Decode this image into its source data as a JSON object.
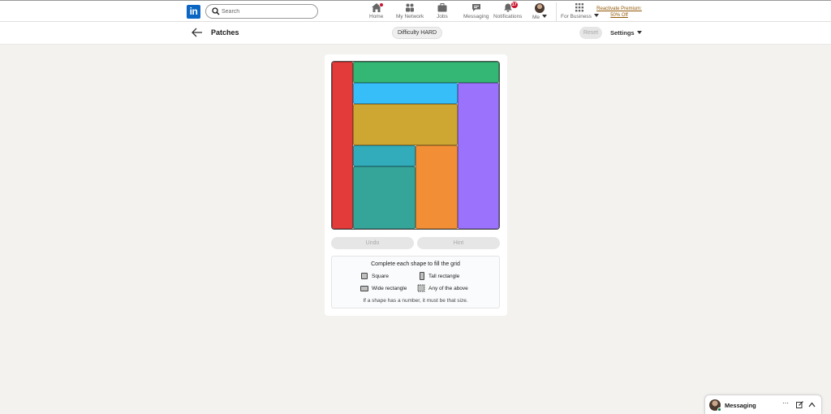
{
  "nav": {
    "logo_text": "in",
    "search_placeholder": "Search",
    "items": [
      {
        "label": "Home",
        "icon": "home-icon"
      },
      {
        "label": "My Network",
        "icon": "network-icon"
      },
      {
        "label": "Jobs",
        "icon": "briefcase-icon"
      },
      {
        "label": "Messaging",
        "icon": "chat-icon"
      },
      {
        "label": "Notifications",
        "icon": "bell-icon",
        "badge": "17"
      },
      {
        "label": "Me",
        "icon": "avatar"
      },
      {
        "label": "For Business",
        "icon": "grid-icon"
      }
    ],
    "premium_line1": "Reactivate Premium:",
    "premium_line2": "50% Off"
  },
  "subheader": {
    "title": "Patches",
    "difficulty": "Difficulty HARD",
    "reset": "Reset",
    "settings": "Settings"
  },
  "board": {
    "grid_size": 8,
    "pieces": [
      {
        "name": "red-tall-piece",
        "color": "#e33a3a",
        "cells": "col 1, rows 1-8"
      },
      {
        "name": "green-wide-piece",
        "color": "#34b774",
        "cells": "cols 2-8, row 1"
      },
      {
        "name": "blue-wide-piece",
        "color": "#37bdf8",
        "cells": "cols 2-6, row 2"
      },
      {
        "name": "purple-tall-piece",
        "color": "#9b72fb",
        "cells": "cols 7-8, rows 2-8"
      },
      {
        "name": "gold-wide-piece",
        "color": "#cea632",
        "cells": "cols 2-6, rows 3-4"
      },
      {
        "name": "cyan-wide-piece",
        "color": "#32abbb",
        "cells": "cols 2-4, row 5"
      },
      {
        "name": "orange-tall-piece",
        "color": "#f18e36",
        "cells": "cols 5-6, rows 5-8"
      },
      {
        "name": "teal-square-piece",
        "color": "#35a59a",
        "cells": "cols 2-4, rows 6-8"
      }
    ]
  },
  "controls": {
    "undo": "Undo",
    "hint": "Hint"
  },
  "legend": {
    "heading": "Complete each shape to fill the grid",
    "square": "Square",
    "tall": "Tall rectangle",
    "wide": "Wide rectangle",
    "any": "Any of the above",
    "footer": "If a shape has a number, it must be that size."
  },
  "messaging": {
    "title": "Messaging"
  }
}
